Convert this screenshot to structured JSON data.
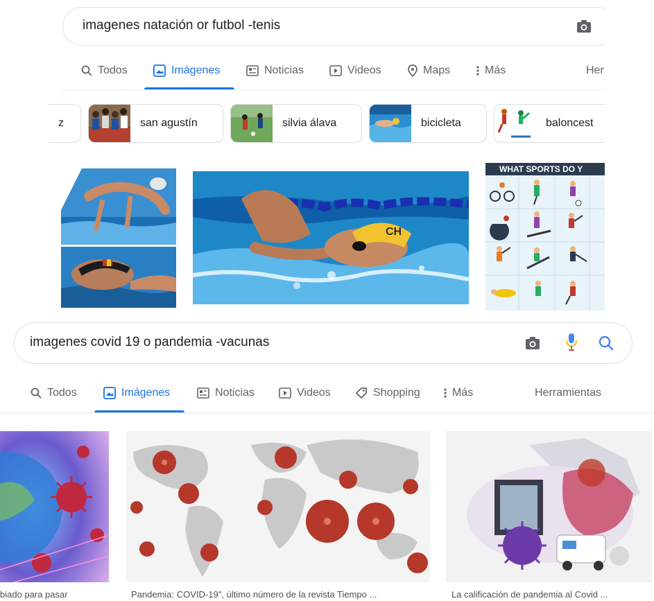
{
  "search1": {
    "query": "imagenes natación or futbol -tenis",
    "tabs": {
      "todos": "Todos",
      "imagenes": "Imágenes",
      "noticias": "Noticias",
      "videos": "Videos",
      "maps": "Maps",
      "mas": "Más",
      "herr": "Her"
    },
    "chips": [
      {
        "label": "z"
      },
      {
        "label": "san agustín"
      },
      {
        "label": "silvia álava"
      },
      {
        "label": "bicicleta"
      },
      {
        "label": "baloncest"
      }
    ],
    "poster_title": "WHAT SPORTS DO Y"
  },
  "search2": {
    "query": "imagenes covid 19 o pandemia -vacunas",
    "tabs": {
      "todos": "Todos",
      "imagenes": "Imágenes",
      "noticias": "Noticias",
      "videos": "Videos",
      "shopping": "Shopping",
      "mas": "Más",
      "herr": "Herramientas"
    },
    "captions": [
      "biado para pasar",
      "Pandemia: COVID-19\", último número de la revista Tiempo ...",
      "La calificación de pandemia al Covid ..."
    ]
  },
  "colors": {
    "accent": "#1a73e8",
    "pool": "#1e88c7",
    "virus": "#c0392b"
  },
  "icons": [
    "camera-icon",
    "mic-icon",
    "search-icon",
    "images-tab-icon",
    "news-tab-icon",
    "video-tab-icon",
    "maps-pin-icon",
    "shopping-tag-icon",
    "more-dots-icon"
  ]
}
